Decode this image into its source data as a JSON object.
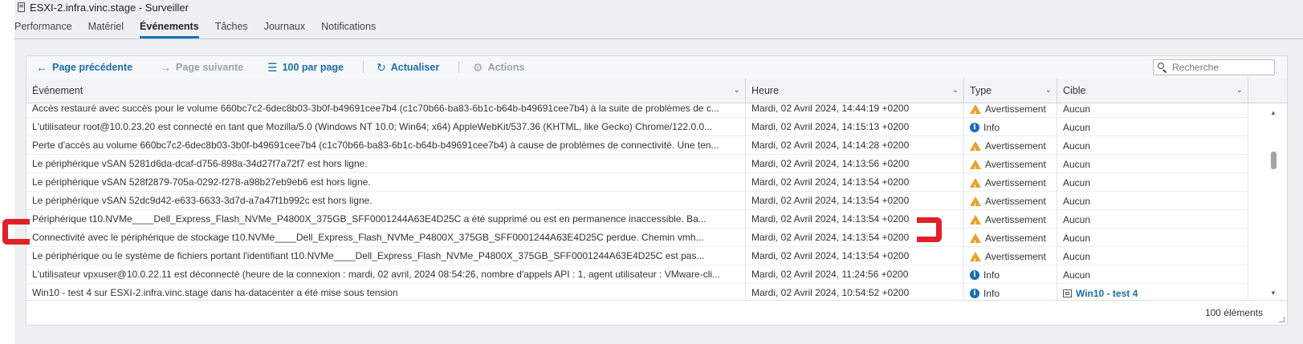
{
  "window": {
    "title": "ESXI-2.infra.vinc.stage - Surveiller"
  },
  "tabs": [
    {
      "label": "Performance",
      "active": false
    },
    {
      "label": "Matériel",
      "active": false
    },
    {
      "label": "Événements",
      "active": true
    },
    {
      "label": "Tâches",
      "active": false
    },
    {
      "label": "Journaux",
      "active": false
    },
    {
      "label": "Notifications",
      "active": false
    }
  ],
  "toolbar": {
    "prev_page": "Page précédente",
    "next_page": "Page suivante",
    "per_page": "100 par page",
    "refresh": "Actualiser",
    "actions": "Actions",
    "search_placeholder": "Recherche"
  },
  "columns": {
    "event": "Événement",
    "time": "Heure",
    "type": "Type",
    "target": "Cible"
  },
  "rows": [
    {
      "event": "Accès restauré avec succès pour le volume 660bc7c2-6dec8b03-3b0f-b49691cee7b4 (c1c70b66-ba83-6b1c-b64b-b49691cee7b4) à la suite de problèmes de c...",
      "time": "Mardi, 02 Avril 2024, 14:44:19 +0200",
      "type": "Avertissement",
      "icon": "warning-icon",
      "target": "Aucun"
    },
    {
      "event": "L'utilisateur root@10.0.23.20 est connecté en tant que Mozilla/5.0 (Windows NT 10.0; Win64; x64) AppleWebKit/537.36 (KHTML, like Gecko) Chrome/122.0.0...",
      "time": "Mardi, 02 Avril 2024, 14:15:13 +0200",
      "type": "Info",
      "icon": "info-icon",
      "target": "Aucun"
    },
    {
      "event": "Perte d'accès au volume 660bc7c2-6dec8b03-3b0f-b49691cee7b4 (c1c70b66-ba83-6b1c-b64b-b49691cee7b4) à cause de problèmes de connectivité. Une ten...",
      "time": "Mardi, 02 Avril 2024, 14:14:28 +0200",
      "type": "Avertissement",
      "icon": "warning-icon",
      "target": "Aucun"
    },
    {
      "event": "Le périphérique vSAN 5281d6da-dcaf-d756-898a-34d27f7a72f7 est hors ligne.",
      "time": "Mardi, 02 Avril 2024, 14:13:56 +0200",
      "type": "Avertissement",
      "icon": "warning-icon",
      "target": "Aucun"
    },
    {
      "event": "Le périphérique vSAN 528f2879-705a-0292-f278-a98b27eb9eb6 est hors ligne.",
      "time": "Mardi, 02 Avril 2024, 14:13:54 +0200",
      "type": "Avertissement",
      "icon": "warning-icon",
      "target": "Aucun"
    },
    {
      "event": "Le périphérique vSAN 52dc9d42-e633-6633-3d7d-a7a47f1b992c est hors ligne.",
      "time": "Mardi, 02 Avril 2024, 14:13:54 +0200",
      "type": "Avertissement",
      "icon": "warning-icon",
      "target": "Aucun"
    },
    {
      "event": "Périphérique t10.NVMe____Dell_Express_Flash_NVMe_P4800X_375GB_SFF0001244A63E4D25C a été supprimé ou est en permanence inaccessible. Ba...",
      "time": "Mardi, 02 Avril 2024, 14:13:54 +0200",
      "type": "Avertissement",
      "icon": "warning-icon",
      "target": "Aucun"
    },
    {
      "event": "Connectivité avec le périphérique de stockage t10.NVMe____Dell_Express_Flash_NVMe_P4800X_375GB_SFF0001244A63E4D25C perdue. Chemin vmh...",
      "time": "Mardi, 02 Avril 2024, 14:13:54 +0200",
      "type": "Avertissement",
      "icon": "warning-icon",
      "target": "Aucun"
    },
    {
      "event": "Le périphérique ou le système de fichiers portant l'identifiant t10.NVMe____Dell_Express_Flash_NVMe_P4800X_375GB_SFF0001244A63E4D25C est pas...",
      "time": "Mardi, 02 Avril 2024, 14:13:54 +0200",
      "type": "Avertissement",
      "icon": "warning-icon",
      "target": "Aucun"
    },
    {
      "event": "L'utilisateur vpxuser@10.0.22.11 est déconnecté (heure de la connexion : mardi, 02 avril, 2024 08:54:26, nombre d'appels API : 1, agent utilisateur : VMware-cli...",
      "time": "Mardi, 02 Avril 2024, 11:24:56 +0200",
      "type": "Info",
      "icon": "info-icon",
      "target": "Aucun"
    },
    {
      "event": "Win10 - test 4 sur ESXI-2.infra.vinc.stage dans ha-datacenter a été mise sous tension",
      "time": "Mardi, 02 Avril 2024, 10:54:52 +0200",
      "type": "Info",
      "icon": "info-icon",
      "target": "Win10 - test 4",
      "target_is_link": true
    }
  ],
  "footer": {
    "count": "100 éléments"
  },
  "colors": {
    "accent": "#1a6ea8",
    "warning": "#e8a22a",
    "info": "#1b6bb5",
    "annotation": "#e0202a"
  }
}
